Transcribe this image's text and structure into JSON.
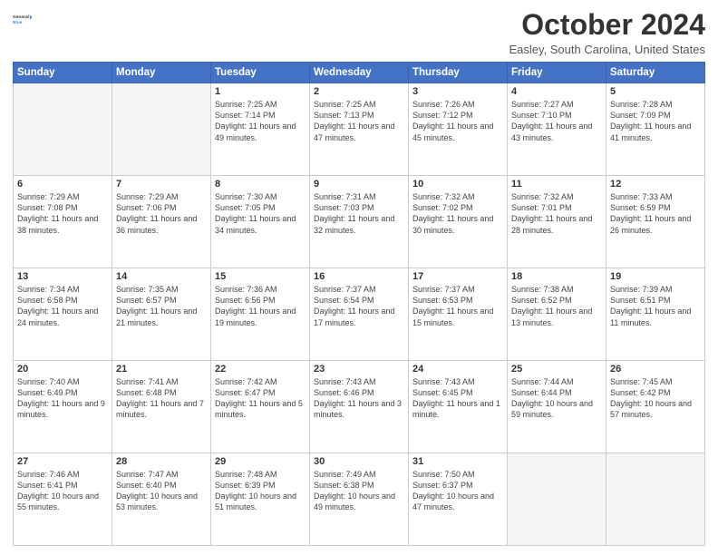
{
  "logo": {
    "line1": "General",
    "line2": "Blue",
    "icon_color": "#4a90d9"
  },
  "header": {
    "title": "October 2024",
    "subtitle": "Easley, South Carolina, United States"
  },
  "weekdays": [
    "Sunday",
    "Monday",
    "Tuesday",
    "Wednesday",
    "Thursday",
    "Friday",
    "Saturday"
  ],
  "weeks": [
    [
      {
        "day": "",
        "empty": true
      },
      {
        "day": "",
        "empty": true
      },
      {
        "day": "1",
        "sunrise": "7:25 AM",
        "sunset": "7:14 PM",
        "daylight": "11 hours and 49 minutes."
      },
      {
        "day": "2",
        "sunrise": "7:25 AM",
        "sunset": "7:13 PM",
        "daylight": "11 hours and 47 minutes."
      },
      {
        "day": "3",
        "sunrise": "7:26 AM",
        "sunset": "7:12 PM",
        "daylight": "11 hours and 45 minutes."
      },
      {
        "day": "4",
        "sunrise": "7:27 AM",
        "sunset": "7:10 PM",
        "daylight": "11 hours and 43 minutes."
      },
      {
        "day": "5",
        "sunrise": "7:28 AM",
        "sunset": "7:09 PM",
        "daylight": "11 hours and 41 minutes."
      }
    ],
    [
      {
        "day": "6",
        "sunrise": "7:29 AM",
        "sunset": "7:08 PM",
        "daylight": "11 hours and 38 minutes."
      },
      {
        "day": "7",
        "sunrise": "7:29 AM",
        "sunset": "7:06 PM",
        "daylight": "11 hours and 36 minutes."
      },
      {
        "day": "8",
        "sunrise": "7:30 AM",
        "sunset": "7:05 PM",
        "daylight": "11 hours and 34 minutes."
      },
      {
        "day": "9",
        "sunrise": "7:31 AM",
        "sunset": "7:03 PM",
        "daylight": "11 hours and 32 minutes."
      },
      {
        "day": "10",
        "sunrise": "7:32 AM",
        "sunset": "7:02 PM",
        "daylight": "11 hours and 30 minutes."
      },
      {
        "day": "11",
        "sunrise": "7:32 AM",
        "sunset": "7:01 PM",
        "daylight": "11 hours and 28 minutes."
      },
      {
        "day": "12",
        "sunrise": "7:33 AM",
        "sunset": "6:59 PM",
        "daylight": "11 hours and 26 minutes."
      }
    ],
    [
      {
        "day": "13",
        "sunrise": "7:34 AM",
        "sunset": "6:58 PM",
        "daylight": "11 hours and 24 minutes."
      },
      {
        "day": "14",
        "sunrise": "7:35 AM",
        "sunset": "6:57 PM",
        "daylight": "11 hours and 21 minutes."
      },
      {
        "day": "15",
        "sunrise": "7:36 AM",
        "sunset": "6:56 PM",
        "daylight": "11 hours and 19 minutes."
      },
      {
        "day": "16",
        "sunrise": "7:37 AM",
        "sunset": "6:54 PM",
        "daylight": "11 hours and 17 minutes."
      },
      {
        "day": "17",
        "sunrise": "7:37 AM",
        "sunset": "6:53 PM",
        "daylight": "11 hours and 15 minutes."
      },
      {
        "day": "18",
        "sunrise": "7:38 AM",
        "sunset": "6:52 PM",
        "daylight": "11 hours and 13 minutes."
      },
      {
        "day": "19",
        "sunrise": "7:39 AM",
        "sunset": "6:51 PM",
        "daylight": "11 hours and 11 minutes."
      }
    ],
    [
      {
        "day": "20",
        "sunrise": "7:40 AM",
        "sunset": "6:49 PM",
        "daylight": "11 hours and 9 minutes."
      },
      {
        "day": "21",
        "sunrise": "7:41 AM",
        "sunset": "6:48 PM",
        "daylight": "11 hours and 7 minutes."
      },
      {
        "day": "22",
        "sunrise": "7:42 AM",
        "sunset": "6:47 PM",
        "daylight": "11 hours and 5 minutes."
      },
      {
        "day": "23",
        "sunrise": "7:43 AM",
        "sunset": "6:46 PM",
        "daylight": "11 hours and 3 minutes."
      },
      {
        "day": "24",
        "sunrise": "7:43 AM",
        "sunset": "6:45 PM",
        "daylight": "11 hours and 1 minute."
      },
      {
        "day": "25",
        "sunrise": "7:44 AM",
        "sunset": "6:44 PM",
        "daylight": "10 hours and 59 minutes."
      },
      {
        "day": "26",
        "sunrise": "7:45 AM",
        "sunset": "6:42 PM",
        "daylight": "10 hours and 57 minutes."
      }
    ],
    [
      {
        "day": "27",
        "sunrise": "7:46 AM",
        "sunset": "6:41 PM",
        "daylight": "10 hours and 55 minutes."
      },
      {
        "day": "28",
        "sunrise": "7:47 AM",
        "sunset": "6:40 PM",
        "daylight": "10 hours and 53 minutes."
      },
      {
        "day": "29",
        "sunrise": "7:48 AM",
        "sunset": "6:39 PM",
        "daylight": "10 hours and 51 minutes."
      },
      {
        "day": "30",
        "sunrise": "7:49 AM",
        "sunset": "6:38 PM",
        "daylight": "10 hours and 49 minutes."
      },
      {
        "day": "31",
        "sunrise": "7:50 AM",
        "sunset": "6:37 PM",
        "daylight": "10 hours and 47 minutes."
      },
      {
        "day": "",
        "empty": true
      },
      {
        "day": "",
        "empty": true
      }
    ]
  ],
  "labels": {
    "sunrise": "Sunrise:",
    "sunset": "Sunset:",
    "daylight": "Daylight:"
  }
}
